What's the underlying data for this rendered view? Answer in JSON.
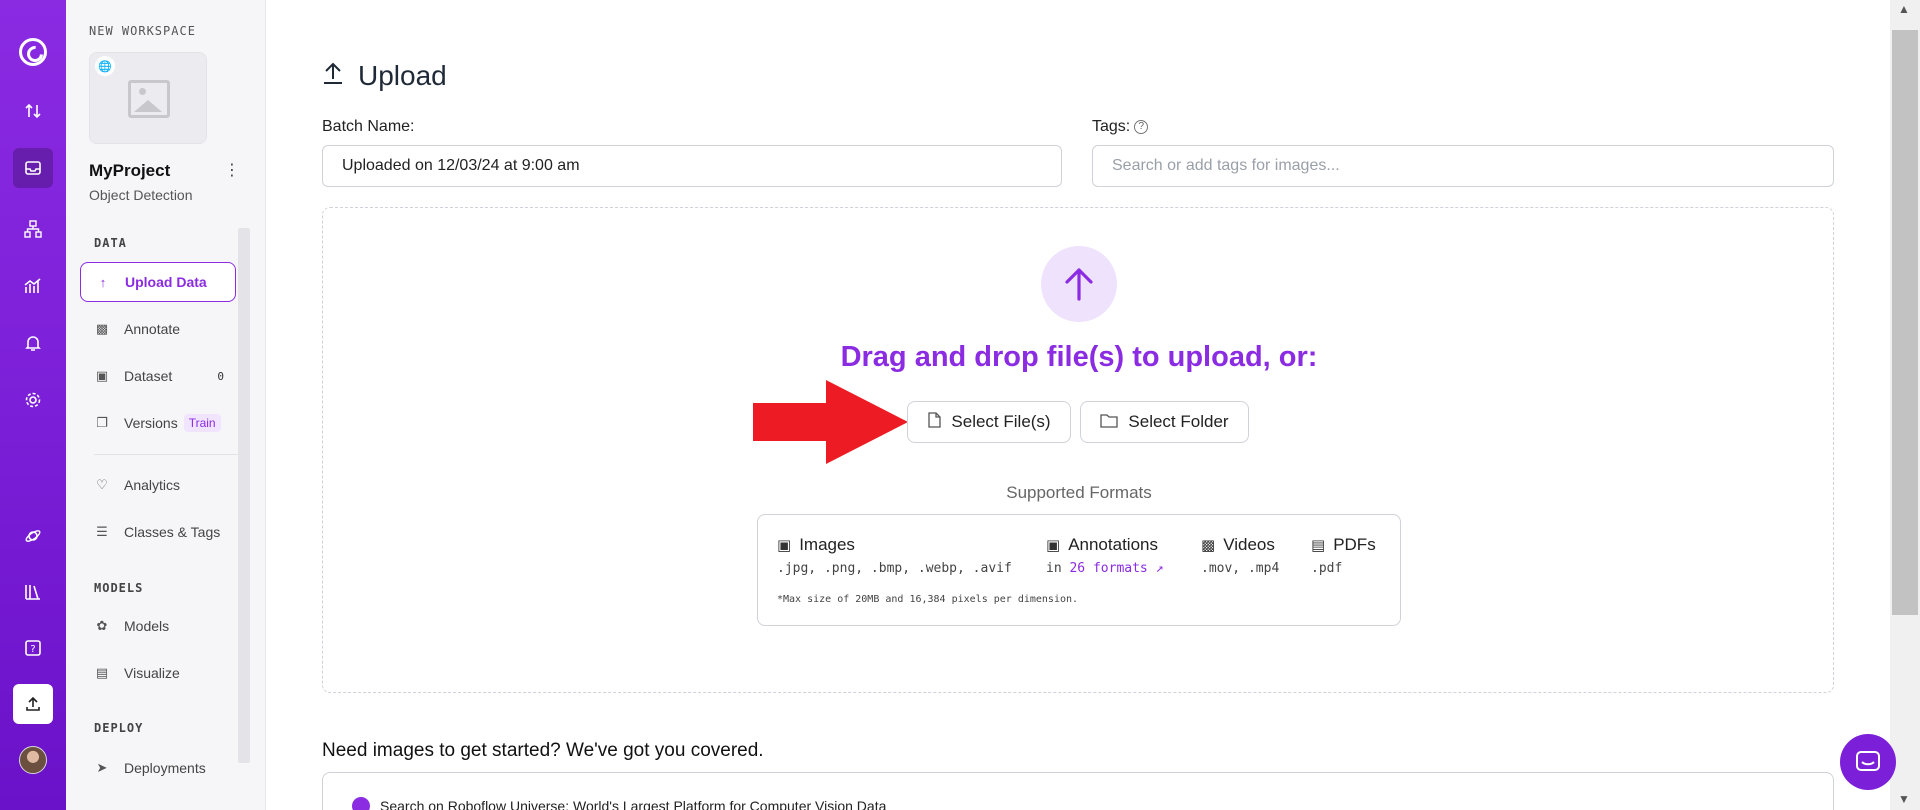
{
  "rail": {
    "icons": [
      "roboflow-logo-icon",
      "transfer-icon",
      "inbox-icon",
      "workflow-icon",
      "analytics-icon",
      "bell-icon",
      "settings-icon",
      "universe-icon",
      "library-icon",
      "help-icon",
      "upload-icon",
      "avatar"
    ]
  },
  "sidebar": {
    "workspace_label": "NEW WORKSPACE",
    "project_name": "MyProject",
    "project_type": "Object Detection",
    "sections": {
      "data": "DATA",
      "models": "MODELS",
      "deploy": "DEPLOY"
    },
    "items": {
      "upload_data": "Upload Data",
      "annotate": "Annotate",
      "dataset": "Dataset",
      "dataset_count": "0",
      "versions": "Versions",
      "versions_badge": "Train",
      "analytics": "Analytics",
      "classes_tags": "Classes & Tags",
      "models": "Models",
      "visualize": "Visualize",
      "deployments": "Deployments"
    }
  },
  "main": {
    "title": "Upload",
    "batch_label": "Batch Name:",
    "batch_value": "Uploaded on 12/03/24 at 9:00 am",
    "tags_label": "Tags:",
    "tags_placeholder": "Search or add tags for images...",
    "drop_text": "Drag and drop file(s) to upload, or:",
    "select_files": "Select File(s)",
    "select_folder": "Select Folder",
    "supported_label": "Supported Formats",
    "formats": {
      "images_title": "Images",
      "images_ext": ".jpg, .png, .bmp, .webp, .avif",
      "annotations_title": "Annotations",
      "annotations_prefix": "in",
      "annotations_link": "26 formats",
      "videos_title": "Videos",
      "videos_ext": ".mov, .mp4",
      "pdfs_title": "PDFs",
      "pdfs_ext": ".pdf",
      "note": "*Max size of 20MB and 16,384 pixels per dimension."
    },
    "need_images": "Need images to get started? We've got you covered.",
    "universe_text": "Search on Roboflow Universe: World's Largest Platform for Computer Vision Data"
  },
  "colors": {
    "accent": "#8b2be2",
    "rail": "#7c1fd8",
    "arrow": "#ed1c24"
  }
}
